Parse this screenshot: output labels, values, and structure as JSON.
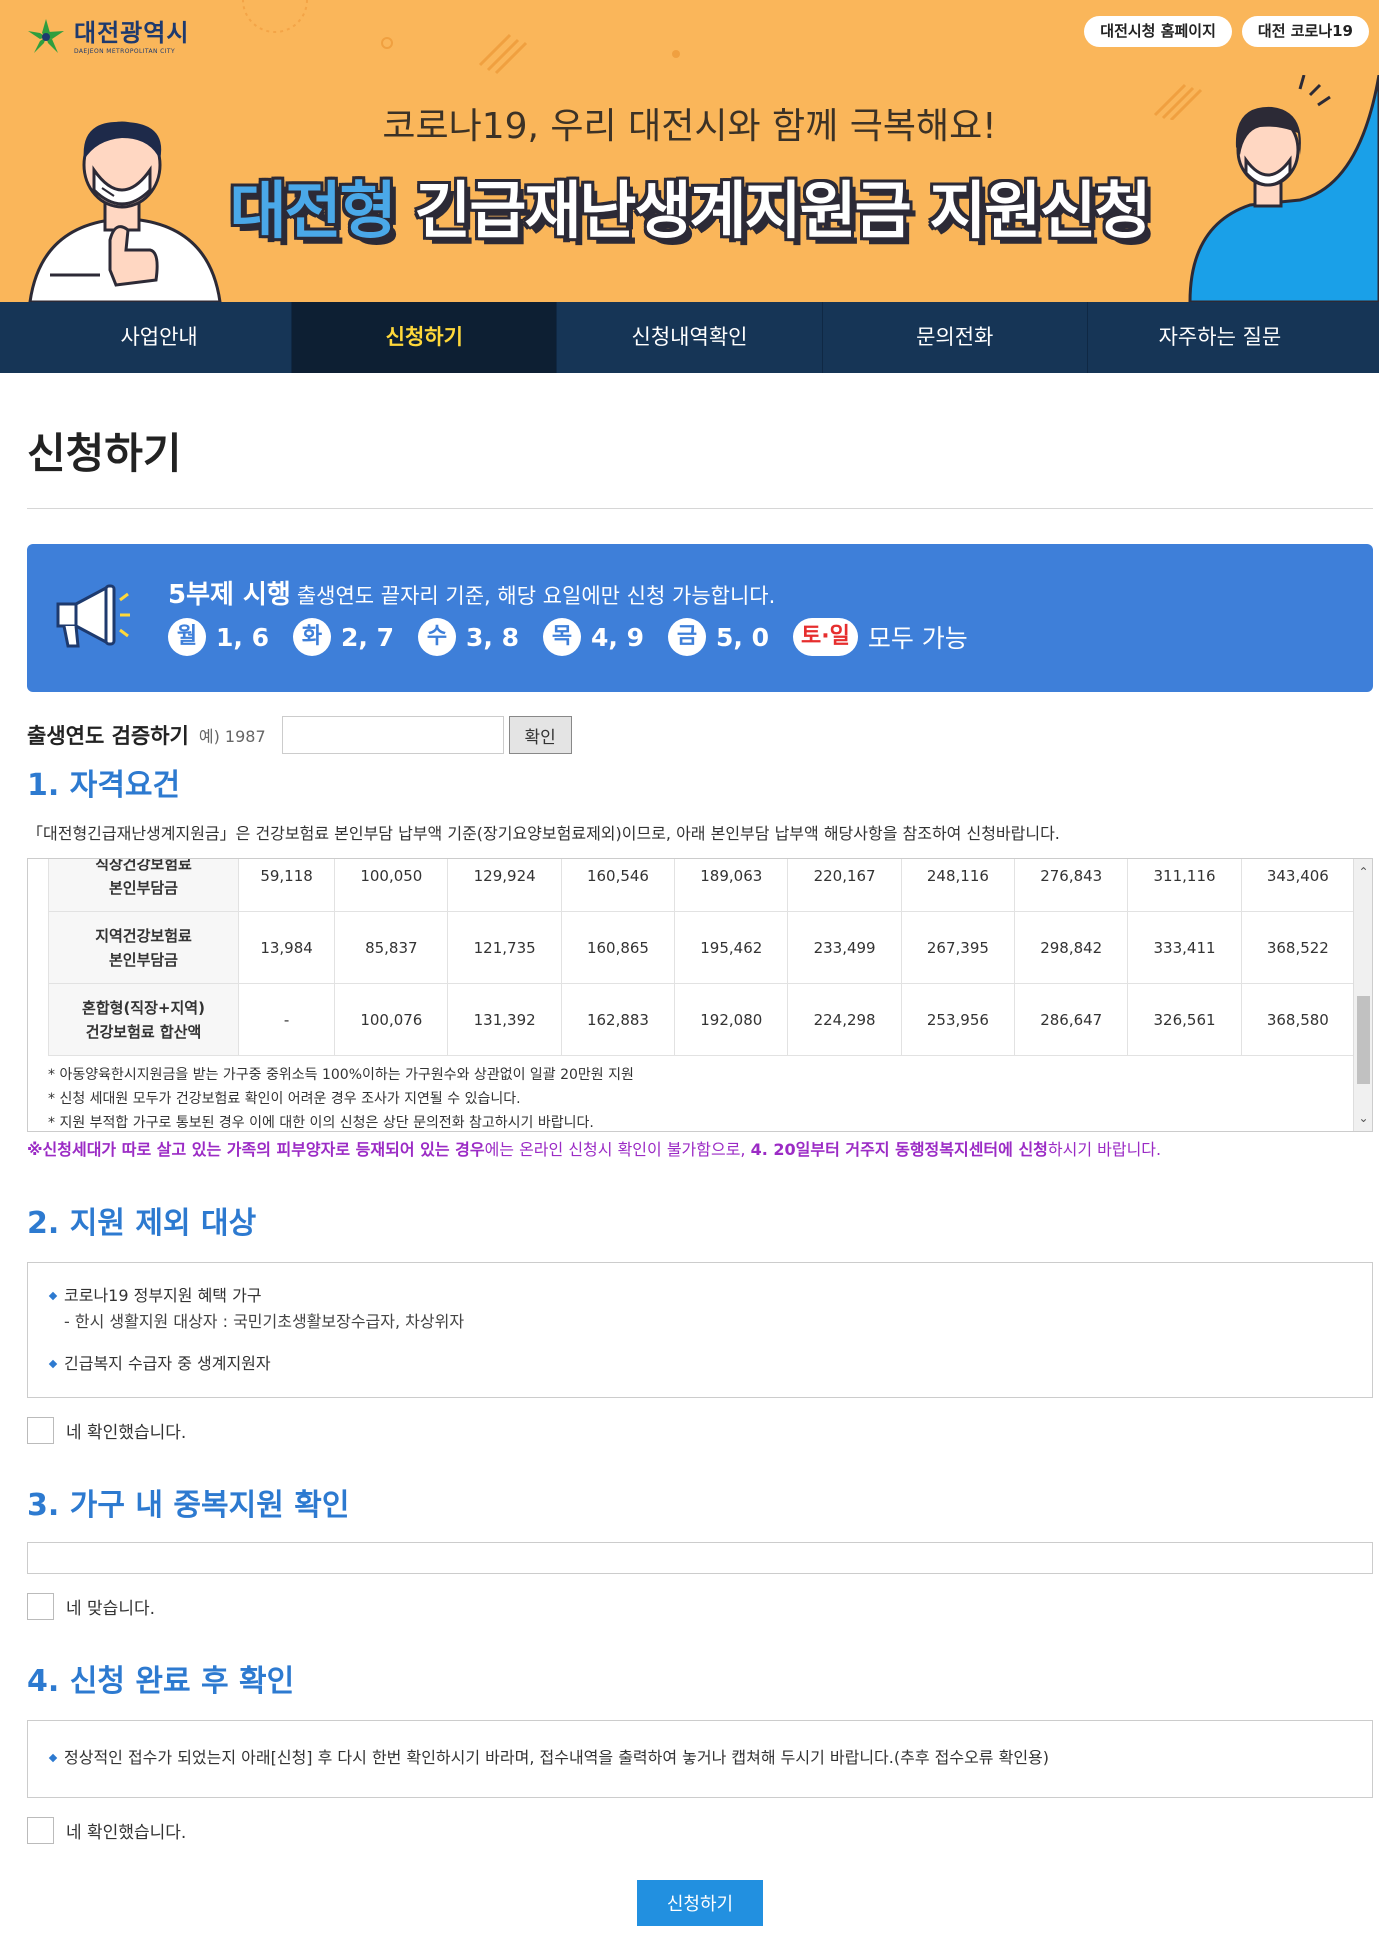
{
  "header": {
    "logo_text": "대전광역시",
    "logo_sub": "DAEJEON METROPOLITAN CITY",
    "links": [
      "대전시청 홈페이지",
      "대전 코로나19"
    ],
    "subtitle": "코로나19, 우리 대전시와 함께 극복해요!",
    "title_highlight": "대전형",
    "title_rest": "긴급재난생계지원금 지원신청"
  },
  "nav": {
    "items": [
      "사업안내",
      "신청하기",
      "신청내역확인",
      "문의전화",
      "자주하는 질문"
    ],
    "active_index": 1
  },
  "page": {
    "title": "신청하기"
  },
  "notice": {
    "bold": "5부제 시행",
    "text": "출생연도 끝자리 기준, 해당 요일에만 신청 가능합니다.",
    "days": [
      {
        "day": "월",
        "nums": "1, 6"
      },
      {
        "day": "화",
        "nums": "2, 7"
      },
      {
        "day": "수",
        "nums": "3, 8"
      },
      {
        "day": "목",
        "nums": "4, 9"
      },
      {
        "day": "금",
        "nums": "5, 0"
      }
    ],
    "weekend": "토·일",
    "weekend_text": "모두 가능",
    "accent_color": "#3e7fd9"
  },
  "verify": {
    "label": "출생연도 검증하기",
    "example": "예) 1987",
    "input_value": "",
    "button": "확인"
  },
  "section1": {
    "title": "1. 자격요건",
    "desc": "「대전형긴급재난생계지원금」은 건강보험료 본인부담 납부액 기준(장기요양보험료제외)이므로, 아래 본인부담 납부액 해당사항을 참조하여 신청바랍니다.",
    "table": [
      {
        "label": [
          "직장건강보험료",
          "본인부담금"
        ],
        "values": [
          "59,118",
          "100,050",
          "129,924",
          "160,546",
          "189,063",
          "220,167",
          "248,116",
          "276,843",
          "311,116",
          "343,406"
        ]
      },
      {
        "label": [
          "지역건강보험료",
          "본인부담금"
        ],
        "values": [
          "13,984",
          "85,837",
          "121,735",
          "160,865",
          "195,462",
          "233,499",
          "267,395",
          "298,842",
          "333,411",
          "368,522"
        ]
      },
      {
        "label": [
          "혼합형(직장+지역)",
          "건강보험료 합산액"
        ],
        "values": [
          "-",
          "100,076",
          "131,392",
          "162,883",
          "192,080",
          "224,298",
          "253,956",
          "286,647",
          "326,561",
          "368,580"
        ]
      }
    ],
    "notes": [
      "* 아동양육한시지원금을 받는 가구중 중위소득 100%이하는 가구원수와 상관없이 일괄 20만원 지원",
      "* 신청 세대원 모두가 건강보험료 확인이 어려운 경우 조사가 지연될 수 있습니다.",
      "* 지원 부적합 가구로 통보된 경우 이에 대한 이의 신청은 상단 문의전화 참고하시기 바랍니다."
    ],
    "warning_bold1": "※신청세대가 따로 살고 있는 가족의 피부양자로 등재되어 있는 경우",
    "warning_mid": "에는 온라인 신청시 확인이 불가함으로,",
    "warning_bold2": "4. 20일부터 거주지 동행정복지센터에 신청",
    "warning_end": "하시기 바랍니다."
  },
  "section2": {
    "title": "2. 지원 제외 대상",
    "bullet1": "코로나19 정부지원 혜택 가구",
    "sub1": "- 한시 생활지원 대상자 : 국민기초생활보장수급자, 차상위자",
    "bullet2": "긴급복지 수급자 중 생계지원자",
    "check_label": "네 확인했습니다."
  },
  "section3": {
    "title": "3. 가구 내 중복지원 확인",
    "check_label": "네 맞습니다."
  },
  "section4": {
    "title": "4. 신청 완료 후 확인",
    "bullet": "정상적인 접수가 되었는지 아래[신청] 후 다시 한번 확인하시기 바라며, 접수내역을 출력하여 놓거나 캡쳐해 두시기 바랍니다.(추후 접수오류 확인용)",
    "check_label": "네 확인했습니다."
  },
  "submit": "신청하기"
}
